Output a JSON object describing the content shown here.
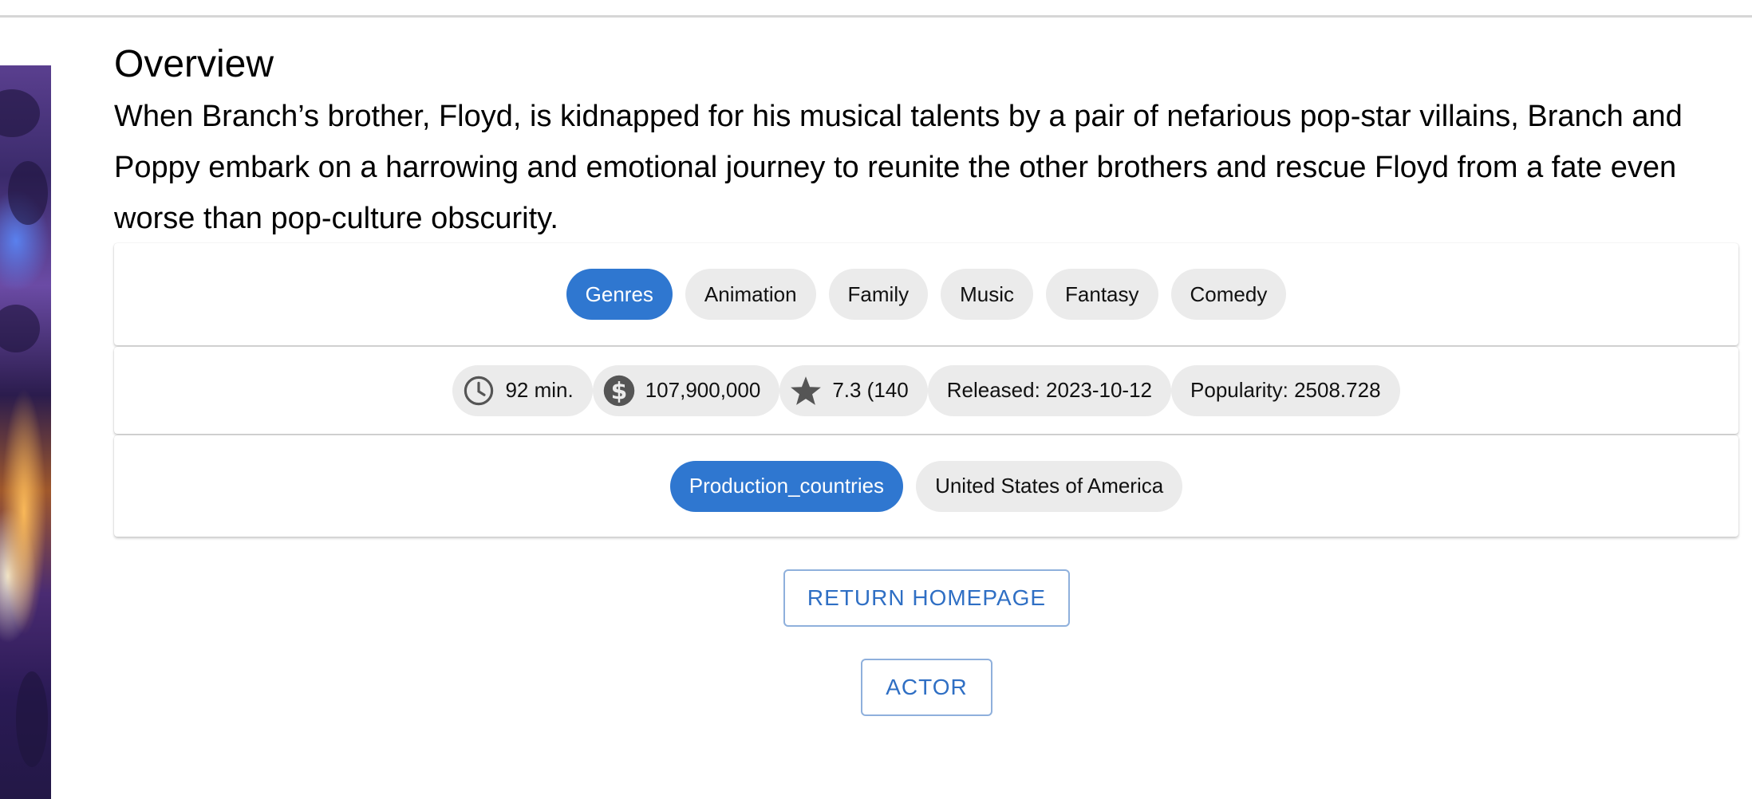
{
  "overview": {
    "title": "Overview",
    "text": "When Branch’s brother, Floyd, is kidnapped for his musical talents by a pair of nefarious pop-star villains, Branch and Poppy embark on a harrowing and emotional journey to reunite the other brothers and rescue Floyd from a fate even worse than pop-culture obscurity."
  },
  "genres": {
    "label": "Genres",
    "items": [
      "Animation",
      "Family",
      "Music",
      "Fantasy",
      "Comedy"
    ]
  },
  "meta": {
    "runtime": "92 min.",
    "runtime_icon": "clock-icon",
    "budget": "107,900,000",
    "budget_icon": "dollar-icon",
    "rating": "7.3 (140",
    "rating_icon": "star-icon",
    "released": "Released: 2023-10-12",
    "popularity": "Popularity: 2508.728"
  },
  "countries": {
    "label": "Production_countries",
    "items": [
      "United States of America"
    ]
  },
  "buttons": {
    "return_home": "RETURN HOMEPAGE",
    "actor": "ACTOR"
  },
  "colors": {
    "primary": "#2f77d0",
    "chip_bg": "#ebebeb",
    "button_text": "#2f6fc4"
  }
}
